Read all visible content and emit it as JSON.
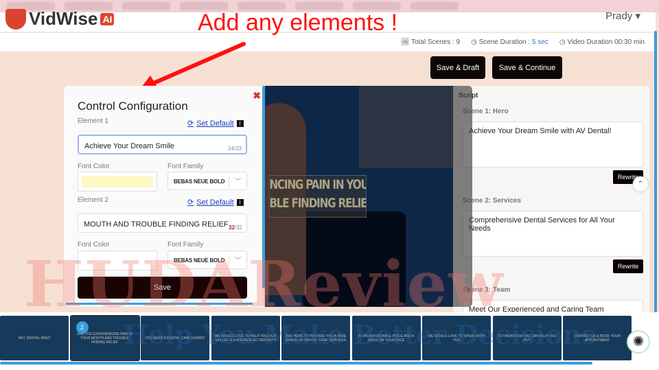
{
  "header": {
    "logo_text": "VidWise",
    "logo_badge": "AI",
    "user": "Prady ▾"
  },
  "annotation": {
    "text": "Add any elements !"
  },
  "stats": {
    "total_scenes": "Total Scenes : 9",
    "scene_duration_label": "Scene Duration : ",
    "scene_duration_value": "5 sec",
    "video_duration": "Video Duration 00:30 min"
  },
  "actions": {
    "save_draft": "Save & Draft",
    "save_continue": "Save & Continue"
  },
  "config": {
    "title": "Control Configuration",
    "close": "✖",
    "set_default": "Set Default",
    "info": "i",
    "element1": {
      "label": "Element 1",
      "value": "Achieve Your Dream Smile",
      "count": "24/33",
      "font_color_label": "Font Color",
      "font_color": "#fdf9c4",
      "font_family_label": "Font Family",
      "font_family": "BEBAS NEUE BOLD"
    },
    "element2": {
      "label": "Element 2",
      "value": "MOUTH AND TROUBLE FINDING RELIEF",
      "count_used": "32",
      "count_max": "/32",
      "font_color_label": "Font Color",
      "font_color": "#ffffff",
      "font_family_label": "Font Family",
      "font_family": "BEBAS NEUE BOLD"
    },
    "save": "Save"
  },
  "preview": {
    "line1": "NCING PAIN IN YOUR",
    "line2": "BLE FINDING RELIEF"
  },
  "script": {
    "title": "Script",
    "scenes": [
      {
        "label": "Scene 1: Hero",
        "text": "Achieve Your Dream Smile with AV Dental!"
      },
      {
        "label": "Scene 2: Services",
        "text": "Comprehensive Dental Services for All Your Needs"
      },
      {
        "label": "Scene 3: Team",
        "text": "Meet Our Experienced and Caring Team"
      }
    ],
    "rewrite": "Rewrite"
  },
  "timeline": {
    "active_badge": "2",
    "thumbnails": [
      "HEY, DENTAL PAIN?",
      "ARE YOU EXPERIENCING PAIN IN YOUR MOUTH AND TROUBLE FINDING RELIEF",
      "YOU NEED A DENTAL CARE EXPERT",
      "WE WOULD LOVE TO HELP YOU OUR SKILLED & EXPERIENCED DENTISTS",
      "ARE HERE TO PROVIDE YOU A WIDE RANGE OF DENTAL CARE SERVICES",
      "AT AN AFFORDABLE PRICE AND A SMILE ON YOUR FACE",
      "WE WOULD LOVE TO SPEAK WITH YOU",
      "TO KNOW HOW WE CAN HELP YOU OUT",
      "CONTACT US & BOOK YOUR APPOINTMENT"
    ]
  },
  "watermark": {
    "line1": "HUDAReview",
    "line2": "Help You Make Better Decisions"
  }
}
